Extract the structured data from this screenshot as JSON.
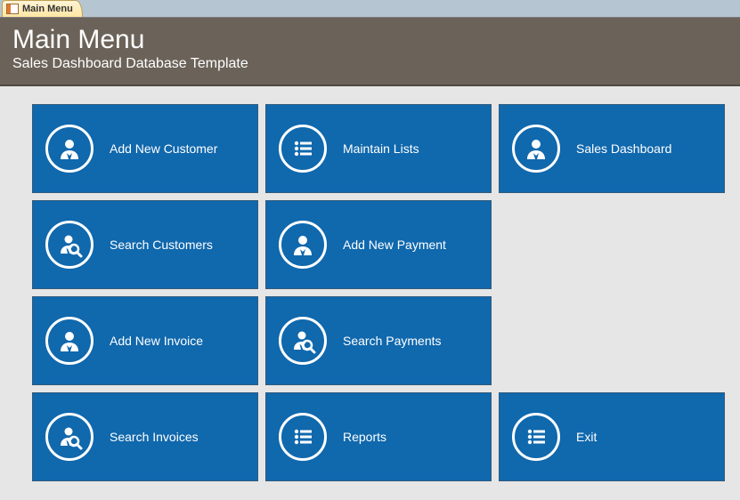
{
  "tab": {
    "label": "Main Menu"
  },
  "header": {
    "title": "Main Menu",
    "subtitle": "Sales Dashboard Database Template"
  },
  "tiles": [
    {
      "label": "Add New Customer",
      "icon": "person",
      "name": "add-new-customer-tile"
    },
    {
      "label": "Maintain Lists",
      "icon": "list",
      "name": "maintain-lists-tile"
    },
    {
      "label": "Sales Dashboard",
      "icon": "person",
      "name": "sales-dashboard-tile"
    },
    {
      "label": "Search Customers",
      "icon": "person-search",
      "name": "search-customers-tile"
    },
    {
      "label": "Add New Payment",
      "icon": "person",
      "name": "add-new-payment-tile"
    },
    null,
    {
      "label": "Add New Invoice",
      "icon": "person",
      "name": "add-new-invoice-tile"
    },
    {
      "label": "Search Payments",
      "icon": "person-search",
      "name": "search-payments-tile"
    },
    null,
    {
      "label": "Search Invoices",
      "icon": "person-search",
      "name": "search-invoices-tile"
    },
    {
      "label": "Reports",
      "icon": "list",
      "name": "reports-tile"
    },
    {
      "label": "Exit",
      "icon": "list",
      "name": "exit-tile"
    }
  ]
}
